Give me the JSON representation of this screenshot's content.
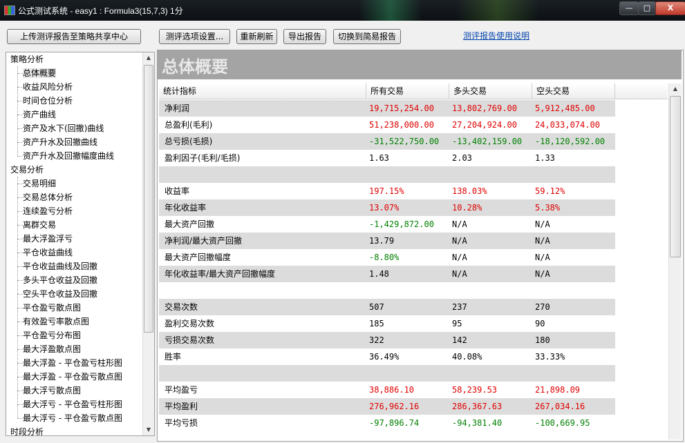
{
  "window": {
    "title": "公式测试系统 - easy1 : Formula3(15,7,3) 1分",
    "min": "—",
    "max": "□",
    "close": "X"
  },
  "toolbar": {
    "upload": "上传测评报告至策略共享中心",
    "options": "测评选项设置...",
    "refresh": "重新刷新",
    "export": "导出报告",
    "simple": "切换到简易报告",
    "help": "测评报告使用说明"
  },
  "tree": {
    "groups": [
      {
        "label": "策略分析",
        "items": [
          "总体概要",
          "收益风险分析",
          "时间仓位分析",
          "资产曲线",
          "资产及水下(回撤)曲线",
          "资产升水及回撤曲线",
          "资产升水及回撤幅度曲线"
        ]
      },
      {
        "label": "交易分析",
        "items": [
          "交易明细",
          "交易总体分析",
          "连续盈亏分析",
          "离群交易",
          "最大浮盈浮亏",
          "平仓收益曲线",
          "平仓收益曲线及回撤",
          "多头平仓收益及回撤",
          "空头平仓收益及回撤",
          "平仓盈亏散点图",
          "有效盈亏率散点图",
          "平仓盈亏分布图",
          "最大浮盈散点图",
          "最大浮盈 - 平仓盈亏柱形图",
          "最大浮盈 - 平仓盈亏散点图",
          "最大浮亏散点图",
          "最大浮亏 - 平仓盈亏柱形图",
          "最大浮亏 - 平仓盈亏散点图"
        ]
      },
      {
        "label": "时段分析",
        "items": []
      }
    ],
    "selected": "总体概要"
  },
  "panel": {
    "title": "总体概要",
    "columns": [
      "统计指标",
      "所有交易",
      "多头交易",
      "空头交易"
    ]
  },
  "colors": {
    "positive": "#e00000",
    "negative": "#008000",
    "neutral": "#000000"
  },
  "rows": [
    {
      "label": "净利润",
      "values": [
        "19,715,254.00",
        "13,802,769.00",
        "5,912,485.00"
      ],
      "colors": [
        "red",
        "red",
        "red"
      ]
    },
    {
      "label": "总盈利(毛利)",
      "values": [
        "51,238,000.00",
        "27,204,924.00",
        "24,033,074.00"
      ],
      "colors": [
        "red",
        "red",
        "red"
      ]
    },
    {
      "label": "总亏损(毛损)",
      "values": [
        "-31,522,750.00",
        "-13,402,159.00",
        "-18,120,592.00"
      ],
      "colors": [
        "green",
        "green",
        "green"
      ]
    },
    {
      "label": "盈利因子(毛利/毛损)",
      "values": [
        "1.63",
        "2.03",
        "1.33"
      ],
      "colors": [
        "black",
        "black",
        "black"
      ]
    },
    {
      "label": "",
      "values": [
        "",
        "",
        ""
      ],
      "colors": [
        "black",
        "black",
        "black"
      ]
    },
    {
      "label": "收益率",
      "values": [
        "197.15%",
        "138.03%",
        "59.12%"
      ],
      "colors": [
        "red",
        "red",
        "red"
      ]
    },
    {
      "label": "年化收益率",
      "values": [
        "13.07%",
        "10.28%",
        "5.38%"
      ],
      "colors": [
        "red",
        "red",
        "red"
      ]
    },
    {
      "label": "最大资产回撤",
      "values": [
        "-1,429,872.00",
        "N/A",
        "N/A"
      ],
      "colors": [
        "green",
        "black",
        "black"
      ]
    },
    {
      "label": "净利润/最大资产回撤",
      "values": [
        "13.79",
        "N/A",
        "N/A"
      ],
      "colors": [
        "black",
        "black",
        "black"
      ]
    },
    {
      "label": "最大资产回撤幅度",
      "values": [
        "-8.80%",
        "N/A",
        "N/A"
      ],
      "colors": [
        "green",
        "black",
        "black"
      ]
    },
    {
      "label": "年化收益率/最大资产回撤幅度",
      "values": [
        "1.48",
        "N/A",
        "N/A"
      ],
      "colors": [
        "black",
        "black",
        "black"
      ]
    },
    {
      "label": "",
      "values": [
        "",
        "",
        ""
      ],
      "colors": [
        "black",
        "black",
        "black"
      ]
    },
    {
      "label": "交易次数",
      "values": [
        "507",
        "237",
        "270"
      ],
      "colors": [
        "black",
        "black",
        "black"
      ]
    },
    {
      "label": "盈利交易次数",
      "values": [
        "185",
        "95",
        "90"
      ],
      "colors": [
        "black",
        "black",
        "black"
      ]
    },
    {
      "label": "亏损交易次数",
      "values": [
        "322",
        "142",
        "180"
      ],
      "colors": [
        "black",
        "black",
        "black"
      ]
    },
    {
      "label": "胜率",
      "values": [
        "36.49%",
        "40.08%",
        "33.33%"
      ],
      "colors": [
        "black",
        "black",
        "black"
      ]
    },
    {
      "label": "",
      "values": [
        "",
        "",
        ""
      ],
      "colors": [
        "black",
        "black",
        "black"
      ]
    },
    {
      "label": "平均盈亏",
      "values": [
        "38,886.10",
        "58,239.53",
        "21,898.09"
      ],
      "colors": [
        "red",
        "red",
        "red"
      ]
    },
    {
      "label": "平均盈利",
      "values": [
        "276,962.16",
        "286,367.63",
        "267,034.16"
      ],
      "colors": [
        "red",
        "red",
        "red"
      ]
    },
    {
      "label": "平均亏损",
      "values": [
        "-97,896.74",
        "-94,381.40",
        "-100,669.95"
      ],
      "colors": [
        "green",
        "green",
        "green"
      ]
    }
  ]
}
